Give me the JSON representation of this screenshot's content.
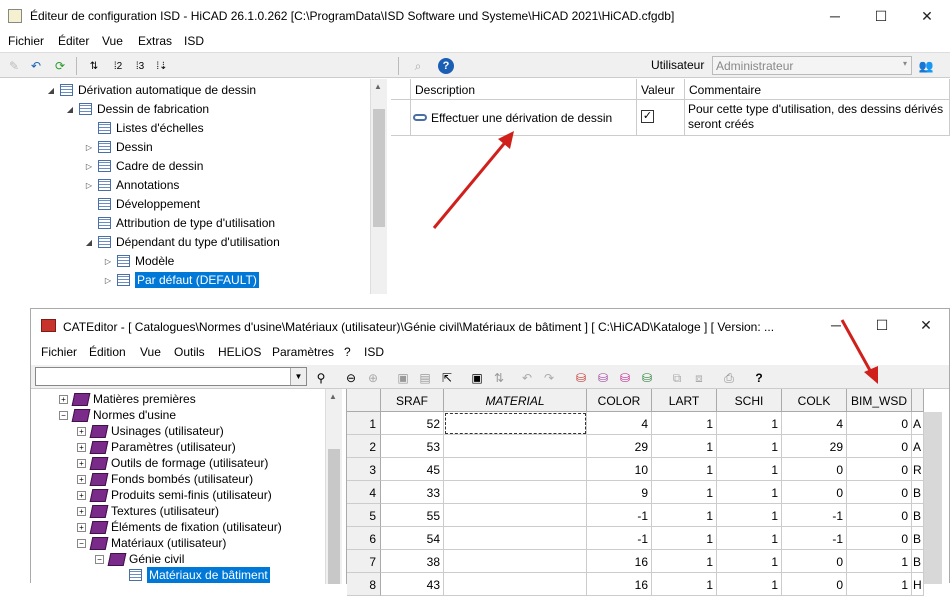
{
  "window1": {
    "title": "Éditeur de configuration ISD  - HiCAD 26.1.0.262 [C:\\ProgramData\\ISD Software und Systeme\\HiCAD 2021\\HiCAD.cfgdb]",
    "controls": {
      "minimize": "─",
      "maximize": "☐",
      "close": "✕"
    },
    "menu": [
      "Fichier",
      "Éditer",
      "Vue",
      "Extras",
      "ISD"
    ],
    "toolbar": {
      "user_label": "Utilisateur",
      "user_value": "Administrateur"
    },
    "tree": [
      {
        "label": "Dérivation automatique de dessin",
        "expanded": true
      },
      {
        "label": "Dessin de fabrication",
        "expanded": true
      },
      {
        "label": "Listes d'échelles"
      },
      {
        "label": "Dessin",
        "expandable": true
      },
      {
        "label": "Cadre de dessin",
        "expandable": true
      },
      {
        "label": "Annotations",
        "expandable": true
      },
      {
        "label": "Développement"
      },
      {
        "label": "Attribution de type d'utilisation"
      },
      {
        "label": "Dépendant du type d'utilisation",
        "expanded": true
      },
      {
        "label": "Modèle",
        "expandable": true
      },
      {
        "label": "Par défaut (DEFAULT)",
        "expandable": true,
        "selected": true
      }
    ],
    "grid": {
      "headers": [
        "Description",
        "Valeur",
        "Commentaire"
      ],
      "row": {
        "description": "Effectuer une dérivation de dessin",
        "value_checked": true,
        "comment": "Pour cette type d'utilisation, des dessins dérivés seront créés"
      }
    }
  },
  "window2": {
    "title": "CATEditor - [ Catalogues\\Normes d'usine\\Matériaux (utilisateur)\\Génie civil\\Matériaux de bâtiment ]    [ C:\\HiCAD\\Kataloge ]   [ Version: ...",
    "menu": [
      "Fichier",
      "Édition",
      "Vue",
      "Outils",
      "HELiOS",
      "Paramètres",
      "?",
      "ISD"
    ],
    "search_icon_label": "🔍",
    "tree": [
      {
        "label": "Matières premières",
        "level": 1,
        "box": "+"
      },
      {
        "label": "Normes d'usine",
        "level": 1,
        "box": "−"
      },
      {
        "label": "Usinages (utilisateur)",
        "level": 2,
        "box": "+"
      },
      {
        "label": "Paramètres (utilisateur)",
        "level": 2,
        "box": "+"
      },
      {
        "label": "Outils de formage (utilisateur)",
        "level": 2,
        "box": "+"
      },
      {
        "label": "Fonds bombés (utilisateur)",
        "level": 2,
        "box": "+"
      },
      {
        "label": "Produits semi-finis (utilisateur)",
        "level": 2,
        "box": "+"
      },
      {
        "label": "Textures (utilisateur)",
        "level": 2,
        "box": "+"
      },
      {
        "label": "Éléments de fixation (utilisateur)",
        "level": 2,
        "box": "+"
      },
      {
        "label": "Matériaux (utilisateur)",
        "level": 2,
        "box": "−"
      },
      {
        "label": "Génie civil",
        "level": 3,
        "box": "−"
      },
      {
        "label": "Matériaux de bâtiment",
        "level": 4,
        "selected": true
      }
    ],
    "table": {
      "columns": [
        "SRAF",
        "MATERIAL",
        "COLOR",
        "LART",
        "SCHI",
        "COLK",
        "BIM_WSD"
      ],
      "rows": [
        {
          "n": "1",
          "cells": [
            "52",
            "",
            "4",
            "1",
            "1",
            "4",
            "0"
          ],
          "extra": "A"
        },
        {
          "n": "2",
          "cells": [
            "53",
            "",
            "29",
            "1",
            "1",
            "29",
            "0"
          ],
          "extra": "A"
        },
        {
          "n": "3",
          "cells": [
            "45",
            "",
            "10",
            "1",
            "1",
            "0",
            "0"
          ],
          "extra": "R"
        },
        {
          "n": "4",
          "cells": [
            "33",
            "",
            "9",
            "1",
            "1",
            "0",
            "0"
          ],
          "extra": "B"
        },
        {
          "n": "5",
          "cells": [
            "55",
            "",
            "-1",
            "1",
            "1",
            "-1",
            "0"
          ],
          "extra": "B"
        },
        {
          "n": "6",
          "cells": [
            "54",
            "",
            "-1",
            "1",
            "1",
            "-1",
            "0"
          ],
          "extra": "B"
        },
        {
          "n": "7",
          "cells": [
            "38",
            "",
            "16",
            "1",
            "1",
            "0",
            "1"
          ],
          "extra": "B"
        },
        {
          "n": "8",
          "cells": [
            "43",
            "",
            "16",
            "1",
            "1",
            "0",
            "1"
          ],
          "extra": "H"
        }
      ]
    }
  },
  "colors": {
    "selection": "#0078d7",
    "arrow": "#d0201c",
    "book": "#7a2b8a"
  }
}
